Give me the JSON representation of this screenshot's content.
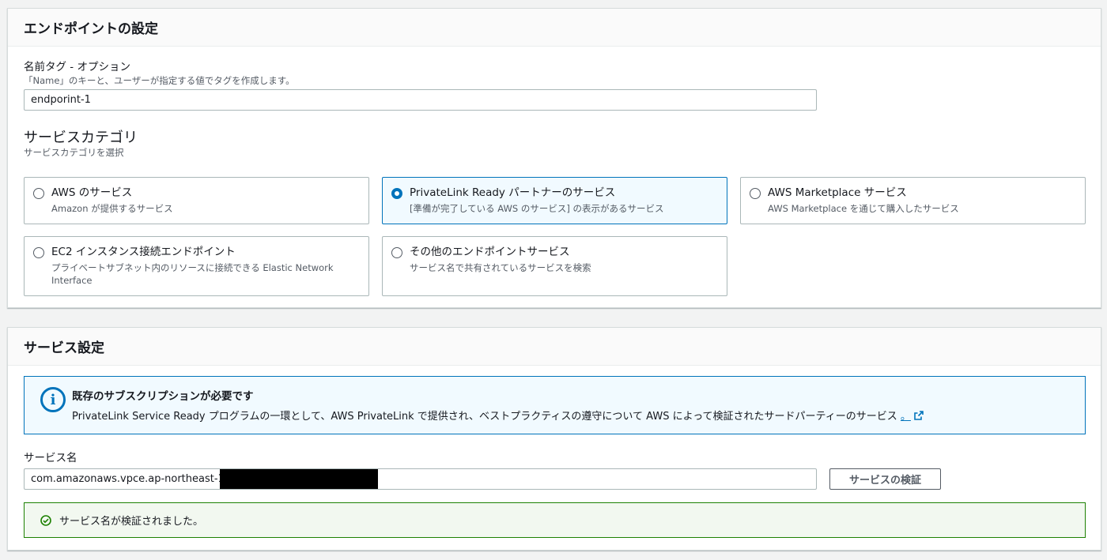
{
  "endpoint_settings": {
    "title": "エンドポイントの設定",
    "name_tag": {
      "label": "名前タグ - オプション",
      "description": "「Name」のキーと、ユーザーが指定する値でタグを作成します。",
      "value": "endporint-1"
    },
    "service_category": {
      "title": "サービスカテゴリ",
      "description": "サービスカテゴリを選択",
      "options": [
        {
          "title": "AWS のサービス",
          "description": "Amazon が提供するサービス",
          "selected": false
        },
        {
          "title": "PrivateLink Ready パートナーのサービス",
          "description": "[準備が完了している AWS のサービス] の表示があるサービス",
          "selected": true
        },
        {
          "title": "AWS Marketplace サービス",
          "description": "AWS Marketplace を通じて購入したサービス",
          "selected": false
        },
        {
          "title": "EC2 インスタンス接続エンドポイント",
          "description": "プライベートサブネット内のリソースに接続できる Elastic Network Interface",
          "selected": false
        },
        {
          "title": "その他のエンドポイントサービス",
          "description": "サービス名で共有されているサービスを検索",
          "selected": false
        }
      ]
    }
  },
  "service_settings": {
    "title": "サービス設定",
    "info_alert": {
      "icon": "info-icon",
      "title": "既存のサブスクリプションが必要です",
      "body": "PrivateLink Service Ready プログラムの一環として、AWS PrivateLink で提供され、ベストプラクティスの遵守について AWS によって検証されたサードパーティーのサービス",
      "link_text": "。",
      "link_icon": "external-link-icon"
    },
    "service_name": {
      "label": "サービス名",
      "value": "com.amazonaws.vpce.ap-northeast-1."
    },
    "verify_button": "サービスの検証",
    "success_alert": {
      "icon": "check-circle-icon",
      "text": "サービス名が検証されました。"
    }
  },
  "colors": {
    "accent": "#0073bb",
    "success": "#1d8102",
    "border": "#aab7b8"
  }
}
